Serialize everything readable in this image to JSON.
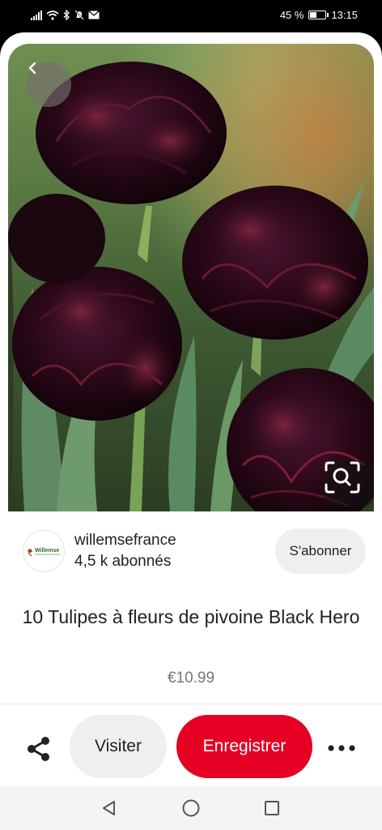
{
  "status_bar": {
    "battery_text": "45 %",
    "battery_level": 0.45,
    "time": "13:15",
    "icons": [
      "signal-icon",
      "wifi-icon",
      "bluetooth-icon",
      "mute-icon",
      "mail-icon"
    ]
  },
  "pin": {
    "image_subject": "dark purple peony tulips",
    "title": "10 Tulipes à fleurs de pivoine Black Hero",
    "price": "€10.99"
  },
  "creator": {
    "name": "willemsefrance",
    "followers": "4,5 k abonnés",
    "avatar_text": "Willemse",
    "follow_label": "S'abonner"
  },
  "actions": {
    "visit_label": "Visiter",
    "save_label": "Enregistrer"
  },
  "colors": {
    "accent": "#e60023",
    "button_gray": "#efefef",
    "text": "#222222",
    "muted": "#777777"
  }
}
